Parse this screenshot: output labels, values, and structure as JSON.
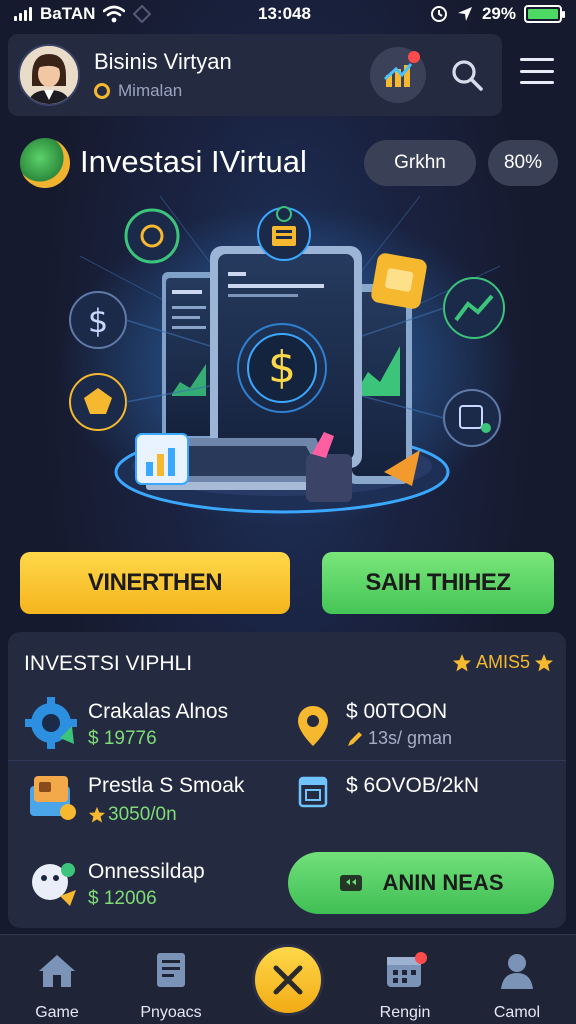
{
  "status": {
    "carrier": "BaTAN",
    "time": "13:048",
    "battery": "29%"
  },
  "header": {
    "user_name": "Bisinis Virtyan",
    "user_sub": "Mimalan"
  },
  "title": {
    "text": "Investasi IVirtual",
    "pill_1": "Grkhn",
    "pill_2": "80%"
  },
  "actions": {
    "primary_label": "VINERTHEN",
    "secondary_label": "SAIH THIHEZ"
  },
  "panel": {
    "title": "INVESTSI VIPHLI",
    "badge": "AMIS5",
    "items": [
      {
        "label": "Crakalas Alnos",
        "value": "$ 19776"
      },
      {
        "label": "$ 00TOON",
        "value": "13s/ gman"
      },
      {
        "label": "Prestla S Smoak",
        "value": "3050/0n"
      },
      {
        "label": "$ 6OVOB/2kN"
      },
      {
        "label": "Onnessildap",
        "value": "$ 12006"
      }
    ],
    "action_label": "ANIN NEAS"
  },
  "nav": {
    "items": [
      {
        "label": "Game",
        "icon": "home-icon"
      },
      {
        "label": "Pnyoacs",
        "icon": "document-icon"
      },
      {
        "label": "Rengin",
        "icon": "calendar-icon"
      },
      {
        "label": "Camol",
        "icon": "user-icon"
      }
    ],
    "fab_icon": "close-icon"
  }
}
